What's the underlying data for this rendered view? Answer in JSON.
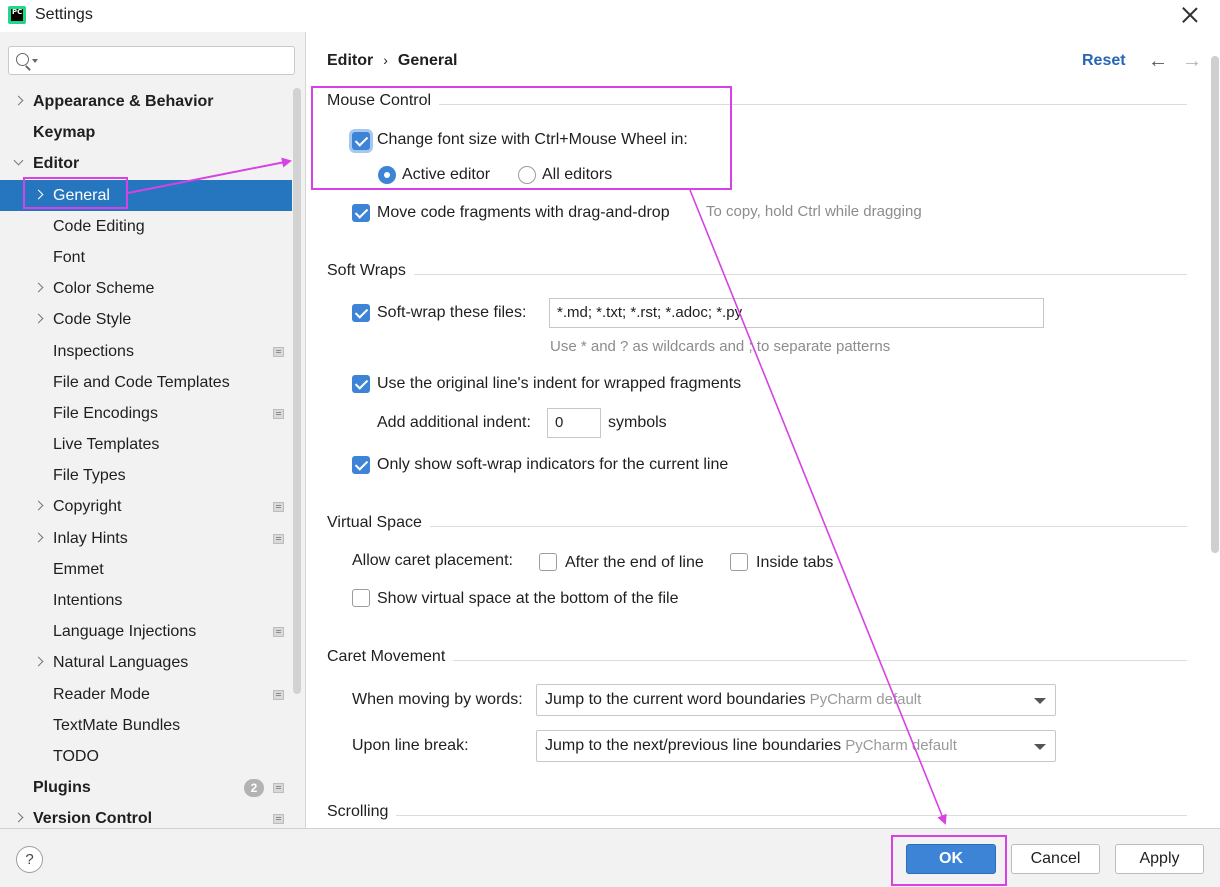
{
  "window": {
    "title": "Settings",
    "app_icon_text": "PC"
  },
  "sidebar": {
    "search": {
      "value": "",
      "placeholder": ""
    },
    "items": [
      {
        "label": "Appearance & Behavior",
        "bold": true,
        "expander": "collapsed",
        "level": 0
      },
      {
        "label": "Keymap",
        "bold": true,
        "expander": "none",
        "level": 0
      },
      {
        "label": "Editor",
        "bold": true,
        "expander": "expanded",
        "level": 0
      },
      {
        "label": "General",
        "expander": "collapsed",
        "level": 1,
        "selected": true
      },
      {
        "label": "Code Editing",
        "expander": "none",
        "level": 1
      },
      {
        "label": "Font",
        "expander": "none",
        "level": 1
      },
      {
        "label": "Color Scheme",
        "expander": "collapsed",
        "level": 1
      },
      {
        "label": "Code Style",
        "expander": "collapsed",
        "level": 1
      },
      {
        "label": "Inspections",
        "expander": "none",
        "level": 1,
        "page_icon": true
      },
      {
        "label": "File and Code Templates",
        "expander": "none",
        "level": 1
      },
      {
        "label": "File Encodings",
        "expander": "none",
        "level": 1,
        "page_icon": true
      },
      {
        "label": "Live Templates",
        "expander": "none",
        "level": 1
      },
      {
        "label": "File Types",
        "expander": "none",
        "level": 1
      },
      {
        "label": "Copyright",
        "expander": "collapsed",
        "level": 1,
        "page_icon": true
      },
      {
        "label": "Inlay Hints",
        "expander": "collapsed",
        "level": 1,
        "page_icon": true
      },
      {
        "label": "Emmet",
        "expander": "none",
        "level": 1
      },
      {
        "label": "Intentions",
        "expander": "none",
        "level": 1
      },
      {
        "label": "Language Injections",
        "expander": "none",
        "level": 1,
        "page_icon": true
      },
      {
        "label": "Natural Languages",
        "expander": "collapsed",
        "level": 1
      },
      {
        "label": "Reader Mode",
        "expander": "none",
        "level": 1,
        "page_icon": true
      },
      {
        "label": "TextMate Bundles",
        "expander": "none",
        "level": 1
      },
      {
        "label": "TODO",
        "expander": "none",
        "level": 1
      },
      {
        "label": "Plugins",
        "bold": true,
        "expander": "none",
        "level": 0,
        "badge": "2",
        "page_icon": true
      },
      {
        "label": "Version Control",
        "bold": true,
        "expander": "collapsed",
        "level": 0,
        "page_icon": true
      }
    ]
  },
  "header": {
    "breadcrumb": [
      "Editor",
      "General"
    ],
    "breadcrumb_sep": "›",
    "reset_label": "Reset",
    "back_icon": "arrow-left-icon",
    "forward_icon": "arrow-right-icon"
  },
  "mouse_control": {
    "title": "Mouse Control",
    "ctrl_wheel": {
      "label": "Change font size with Ctrl+Mouse Wheel in:",
      "checked": true
    },
    "active_editor": {
      "label": "Active editor",
      "selected": true
    },
    "all_editors": {
      "label": "All editors",
      "selected": false
    },
    "drag_drop": {
      "label": "Move code fragments with drag-and-drop",
      "checked": true,
      "hint": "To copy, hold Ctrl while dragging"
    }
  },
  "soft_wraps": {
    "title": "Soft Wraps",
    "wrap_files": {
      "label": "Soft-wrap these files:",
      "checked": true,
      "value": "*.md; *.txt; *.rst; *.adoc; *.py"
    },
    "wrap_hint": "Use * and ? as wildcards and ; to separate patterns",
    "original_indent": {
      "label": "Use the original line's indent for wrapped fragments",
      "checked": true
    },
    "additional_indent": {
      "label": "Add additional indent:",
      "value": "0",
      "unit": "symbols"
    },
    "indicators": {
      "label": "Only show soft-wrap indicators for the current line",
      "checked": true
    }
  },
  "virtual_space": {
    "title": "Virtual Space",
    "caret_label": "Allow caret placement:",
    "after_end": {
      "label": "After the end of line",
      "checked": false
    },
    "inside_tabs": {
      "label": "Inside tabs",
      "checked": false
    },
    "show_bottom": {
      "label": "Show virtual space at the bottom of the file",
      "checked": false
    }
  },
  "caret_movement": {
    "title": "Caret Movement",
    "by_words": {
      "label": "When moving by words:",
      "value": "Jump to the current word boundaries",
      "sub": "PyCharm default"
    },
    "line_break": {
      "label": "Upon line break:",
      "value": "Jump to the next/previous line boundaries",
      "sub": "PyCharm default"
    }
  },
  "scrolling": {
    "title": "Scrolling"
  },
  "footer": {
    "help_label": "?",
    "ok_label": "OK",
    "cancel_label": "Cancel",
    "apply_label": "Apply"
  },
  "colors": {
    "accent": "#3d84d6",
    "selection": "#2675bf",
    "annotation": "#d642e3",
    "link": "#2667b5"
  }
}
